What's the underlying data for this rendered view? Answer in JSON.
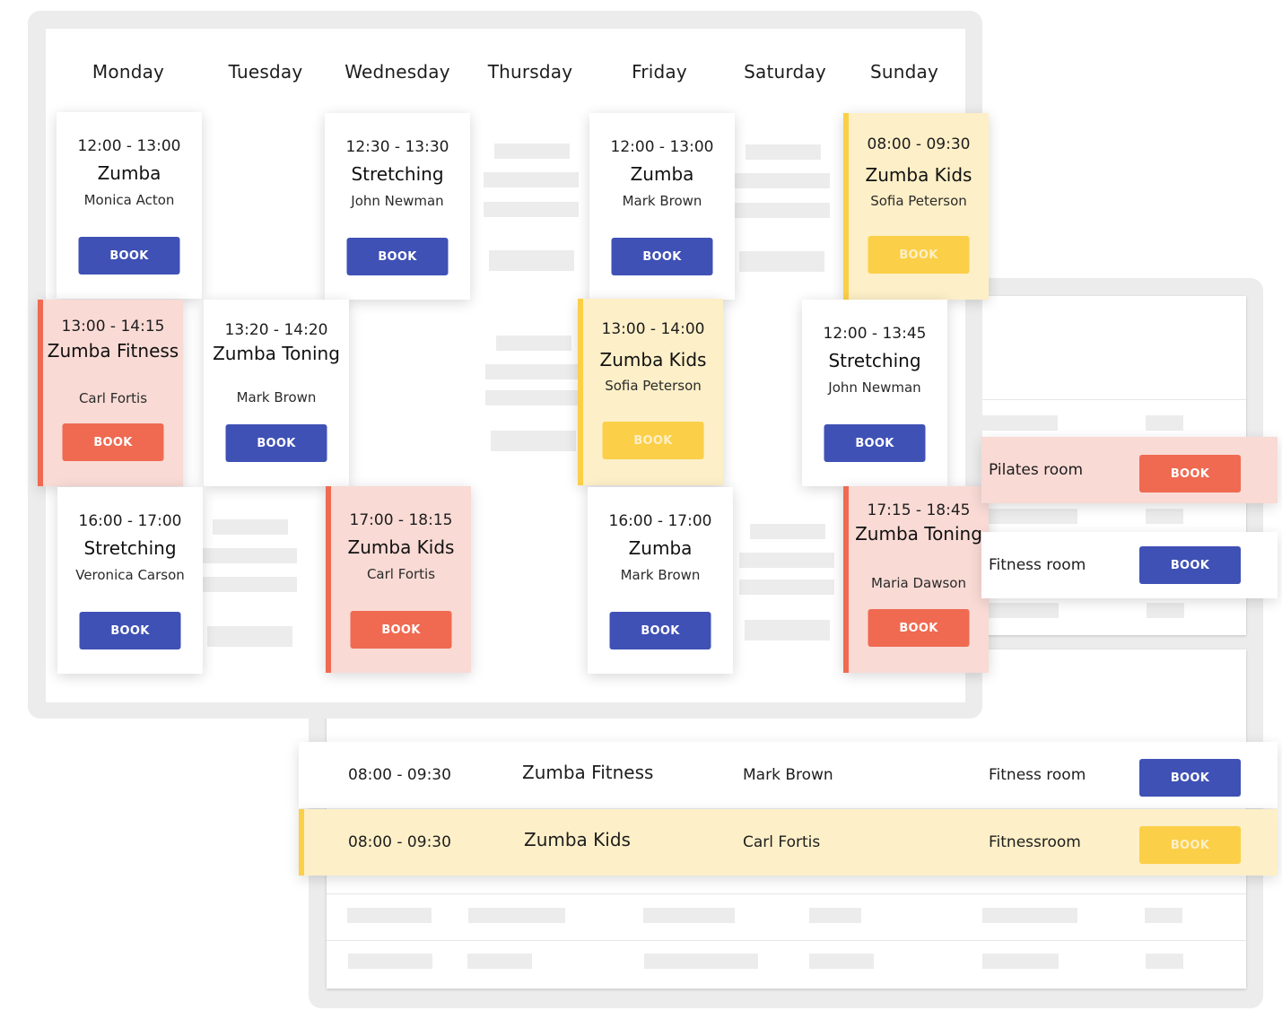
{
  "schedule": {
    "days": [
      "Monday",
      "Tuesday",
      "Wednesday",
      "Thursday",
      "Friday",
      "Saturday",
      "Sunday"
    ],
    "book_label": "BOOK",
    "cards": [
      {
        "day": "Monday",
        "time": "12:00 - 13:00",
        "title": "Zumba",
        "instructor": "Monica Acton",
        "variant": "default"
      },
      {
        "day": "Wednesday",
        "time": "12:30 - 13:30",
        "title": "Stretching",
        "instructor": "John Newman",
        "variant": "default"
      },
      {
        "day": "Friday",
        "time": "12:00 - 13:00",
        "title": "Zumba",
        "instructor": "Mark Brown",
        "variant": "default"
      },
      {
        "day": "Sunday",
        "time": "08:00 - 09:30",
        "title": "Zumba Kids",
        "instructor": "Sofia Peterson",
        "variant": "yellow"
      },
      {
        "day": "Monday",
        "time": "13:00 - 14:15",
        "title": "Zumba Fitness",
        "instructor": "Carl Fortis",
        "variant": "red"
      },
      {
        "day": "Tuesday",
        "time": "13:20 - 14:20",
        "title": "Zumba Toning",
        "instructor": "Mark Brown",
        "variant": "default"
      },
      {
        "day": "Friday",
        "time": "13:00 - 14:00",
        "title": "Zumba Kids",
        "instructor": "Sofia Peterson",
        "variant": "yellow"
      },
      {
        "day": "Saturday",
        "time": "12:00 - 13:45",
        "title": "Stretching",
        "instructor": "John Newman",
        "variant": "default"
      },
      {
        "day": "Monday",
        "time": "16:00 - 17:00",
        "title": "Stretching",
        "instructor": "Veronica Carson",
        "variant": "default"
      },
      {
        "day": "Wednesday",
        "time": "17:00 - 18:15",
        "title": "Zumba Kids",
        "instructor": "Carl Fortis",
        "variant": "red"
      },
      {
        "day": "Friday",
        "time": "16:00 - 17:00",
        "title": "Zumba",
        "instructor": "Mark Brown",
        "variant": "default"
      },
      {
        "day": "Sunday",
        "time": "17:15 - 18:45",
        "title": "Zumba Toning",
        "instructor": "Maria Dawson",
        "variant": "red"
      }
    ]
  },
  "list_view": {
    "book_label": "BOOK",
    "side_rows": [
      {
        "room": "Pilates room",
        "variant": "red"
      },
      {
        "room": "Fitness room",
        "variant": "white"
      }
    ],
    "rows": [
      {
        "time": "08:00 - 09:30",
        "title": "Zumba Fitness",
        "instructor": "Mark Brown",
        "room": "Fitness room",
        "variant": "white"
      },
      {
        "time": "08:00 - 09:30",
        "title": "Zumba Kids",
        "instructor": "Carl Fortis",
        "room": "Fitnessroom",
        "variant": "yellow"
      }
    ]
  },
  "colors": {
    "primary": "#3f51b5",
    "danger": "#ef6a51",
    "warning": "#fbcf48",
    "danger_bg": "#f9dad5",
    "warning_bg": "#fdefc7",
    "skeleton": "#ececec"
  }
}
